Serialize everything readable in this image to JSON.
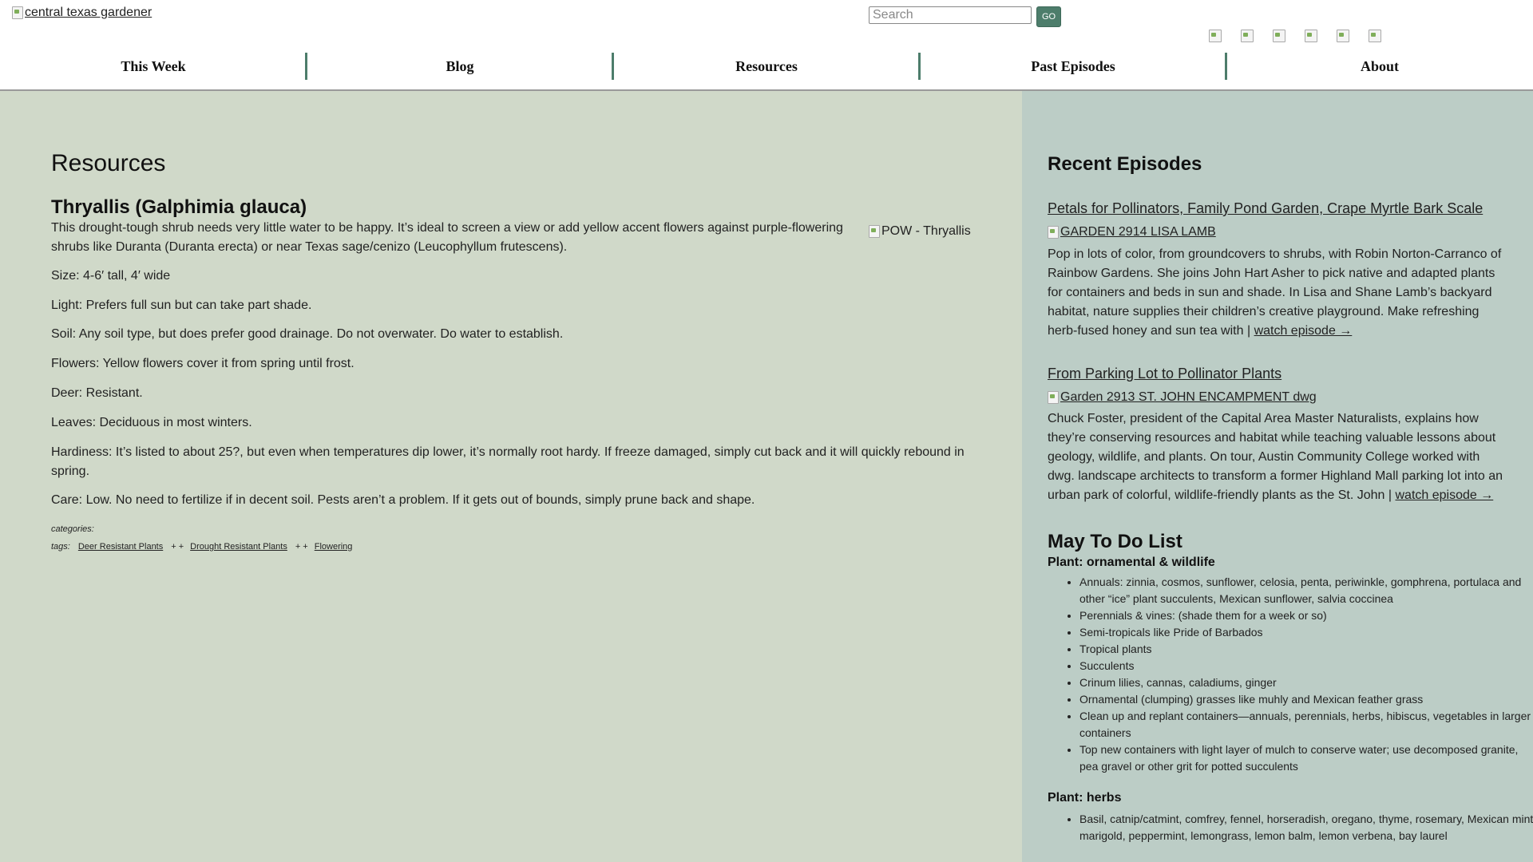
{
  "header": {
    "logo_alt": "central texas gardener",
    "search_placeholder": "Search",
    "go_label": "GO",
    "social_icons": [
      "facebook-icon",
      "twitter-icon",
      "instagram-icon",
      "youtube-icon",
      "pinterest-icon",
      "rss-icon"
    ]
  },
  "nav": [
    "This Week",
    "Blog",
    "Resources",
    "Past Episodes",
    "About"
  ],
  "colors": {
    "accent": "#4d7d6b",
    "main_bg": "#d0d9c9",
    "sidebar_bg": "#bccdc6"
  },
  "main": {
    "page_title": "Resources",
    "article_title": "Thryallis (Galphimia glauca)",
    "image_alt": "POW - Thryallis",
    "intro": "This drought-tough shrub needs very little water to be happy. It’s ideal to screen a view or add yellow accent flowers against purple-flowering shrubs like Duranta (Duranta erecta) or near Texas sage/cenizo (Leucophyllum frutescens).",
    "size": "Size: 4-6′ tall, 4′ wide",
    "light": "Light: Prefers full sun but can take part shade.",
    "soil": "Soil: Any soil type, but does prefer good drainage. Do not overwater. Do water to establish.",
    "flowers": "Flowers: Yellow flowers cover it from spring until frost.",
    "deer": "Deer: Resistant.",
    "leaves": "Leaves: Deciduous in most winters.",
    "hardiness": "Hardiness: It’s listed to about 25?, but even when temperatures dip lower, it’s normally root hardy. If freeze damaged, simply cut back and it will quickly rebound in spring.",
    "care": "Care: Low. No need to fertilize if in decent soil. Pests aren’t a problem. If it gets out of bounds, simply prune back and shape.",
    "categories_label": "categories:",
    "tags_label": "tags:",
    "tags": [
      "Deer Resistant Plants",
      "Drought Resistant Plants",
      "Flowering"
    ],
    "tag_separator": "+ +"
  },
  "sidebar": {
    "recent_title": "Recent Episodes",
    "episodes": [
      {
        "title": "Petals for Pollinators, Family Pond Garden, Crape Myrtle Bark Scale",
        "image_alt": "GARDEN 2914 LISA LAMB",
        "description": "Pop in lots of color, from groundcovers to shrubs, with Robin Norton-Carranco of Rainbow Gardens. She joins John Hart Asher to pick native and adapted plants for containers and beds in sun and shade. In Lisa and Shane Lamb’s backyard habitat, nature supplies their children’s creative playground. Make refreshing herb-fused honey and sun tea with |",
        "link": "watch episode →"
      },
      {
        "title": "From Parking Lot to Pollinator Plants",
        "image_alt": "Garden 2913 ST. JOHN ENCAMPMENT dwg",
        "description": "Chuck Foster, president of the Capital Area Master Naturalists, explains how they’re conserving resources and habitat while teaching valuable lessons about geology, wildlife, and plants. On tour, Austin Community College worked with dwg. landscape architects to transform a former Highland Mall parking lot into an urban park of colorful, wildlife-friendly plants as the St. John |",
        "link": "watch episode →"
      }
    ],
    "todo_title": "May To Do List",
    "todo_sections": [
      {
        "heading": "Plant: ornamental & wildlife",
        "items": [
          "Annuals:  zinnia, cosmos, sunflower, celosia, penta, periwinkle, gomphrena, portulaca and other “ice” plant succulents, Mexican sunflower, salvia coccinea",
          "Perennials & vines:  (shade them for a week or so)",
          "Semi-tropicals like Pride of Barbados",
          "Tropical plants",
          "Succulents",
          "Crinum lilies, cannas, caladiums, ginger",
          "Ornamental (clumping) grasses like muhly and Mexican feather grass",
          "Clean up and replant containers—annuals, perennials, herbs, hibiscus, vegetables in larger containers",
          "Top new containers with light layer of mulch to conserve water; use decomposed granite, pea gravel or other grit for potted succulents"
        ]
      },
      {
        "heading": "Plant: herbs",
        "items": [
          "Basil, catnip/catmint, comfrey, fennel, horseradish, oregano, thyme, rosemary, Mexican mint marigold, peppermint, lemongrass, lemon balm, lemon verbena, bay laurel"
        ]
      }
    ]
  }
}
